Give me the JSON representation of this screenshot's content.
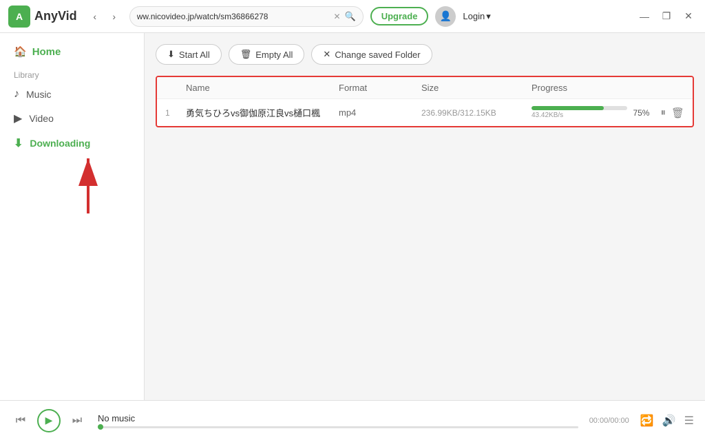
{
  "app": {
    "name": "AnyVid",
    "logo_letter": "A"
  },
  "titlebar": {
    "url": "ww.nicovideo.jp/watch/sm36866278",
    "upgrade_label": "Upgrade",
    "login_label": "Login",
    "back_arrow": "‹",
    "forward_arrow": "›",
    "close_icon": "✕",
    "minimize_icon": "—",
    "maximize_icon": "❐"
  },
  "toolbar": {
    "start_all_label": "Start All",
    "empty_all_label": "Empty All",
    "change_folder_label": "Change saved Folder",
    "start_icon": "⬇",
    "empty_icon": "🗑",
    "folder_icon": "✕"
  },
  "table": {
    "headers": [
      "",
      "Name",
      "Format",
      "Size",
      "Progress"
    ],
    "rows": [
      {
        "num": "1",
        "name": "勇気ちひろvs御伽原江良vs樋口楓",
        "format": "mp4",
        "size": "236.99KB/312.15KB",
        "progress_pct": 75,
        "progress_pct_label": "75%",
        "speed": "43.42KB/s"
      }
    ]
  },
  "sidebar": {
    "home_label": "Home",
    "library_label": "Library",
    "music_label": "Music",
    "video_label": "Video",
    "downloading_label": "Downloading"
  },
  "player": {
    "no_music_label": "No music",
    "time_label": "00:00/00:00",
    "progress_pct": 0
  },
  "colors": {
    "green": "#4caf50",
    "red_border": "#e53935",
    "arrow_red": "#d32f2f"
  }
}
